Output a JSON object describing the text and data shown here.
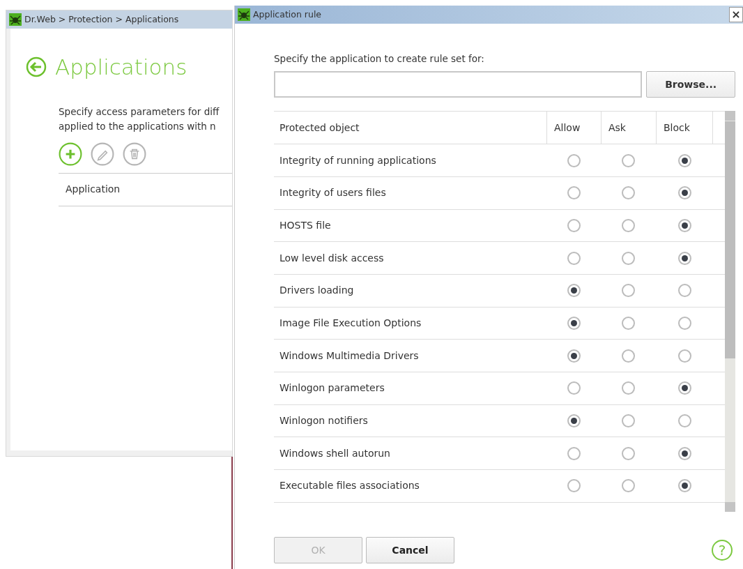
{
  "main_window": {
    "breadcrumb": "Dr.Web > Protection > Applications",
    "heading": "Applications",
    "description_lines": [
      "Specify access parameters for diff",
      "applied to the applications with n"
    ],
    "toolbar": [
      {
        "kind": "add",
        "disabled": false
      },
      {
        "kind": "edit",
        "disabled": true
      },
      {
        "kind": "delete",
        "disabled": true
      }
    ],
    "table": {
      "columns": [
        "Application"
      ]
    }
  },
  "dialog": {
    "title": "Application rule",
    "close": "×",
    "prompt": "Specify the application to create rule set for:",
    "browse_button": "Browse...",
    "table": {
      "columns": [
        "Protected object",
        "Allow",
        "Ask",
        "Block"
      ],
      "rows": [
        {
          "name": "Integrity of running applications",
          "choices": [
            {
              "selected": false
            },
            {
              "selected": false
            },
            {
              "selected": true
            }
          ]
        },
        {
          "name": "Integrity of users files",
          "choices": [
            {
              "selected": false
            },
            {
              "selected": false
            },
            {
              "selected": true
            }
          ]
        },
        {
          "name": "HOSTS file",
          "choices": [
            {
              "selected": false
            },
            {
              "selected": false
            },
            {
              "selected": true
            }
          ]
        },
        {
          "name": "Low level disk access",
          "choices": [
            {
              "selected": false
            },
            {
              "selected": false
            },
            {
              "selected": true
            }
          ]
        },
        {
          "name": "Drivers loading",
          "choices": [
            {
              "selected": true
            },
            {
              "selected": false
            },
            {
              "selected": false
            }
          ]
        },
        {
          "name": "Image File Execution Options",
          "choices": [
            {
              "selected": true
            },
            {
              "selected": false
            },
            {
              "selected": false
            }
          ]
        },
        {
          "name": "Windows Multimedia Drivers",
          "choices": [
            {
              "selected": true
            },
            {
              "selected": false
            },
            {
              "selected": false
            }
          ]
        },
        {
          "name": "Winlogon parameters",
          "choices": [
            {
              "selected": false
            },
            {
              "selected": false
            },
            {
              "selected": true
            }
          ]
        },
        {
          "name": "Winlogon notifiers",
          "choices": [
            {
              "selected": true
            },
            {
              "selected": false
            },
            {
              "selected": false
            }
          ]
        },
        {
          "name": "Windows shell autorun",
          "choices": [
            {
              "selected": false
            },
            {
              "selected": false
            },
            {
              "selected": true
            }
          ]
        },
        {
          "name": "Executable files associations",
          "choices": [
            {
              "selected": false
            },
            {
              "selected": false
            },
            {
              "selected": true
            }
          ]
        }
      ]
    },
    "buttons": [
      {
        "label": "OK",
        "disabled": true
      },
      {
        "label": "Cancel",
        "disabled": false
      }
    ],
    "help": "?"
  }
}
